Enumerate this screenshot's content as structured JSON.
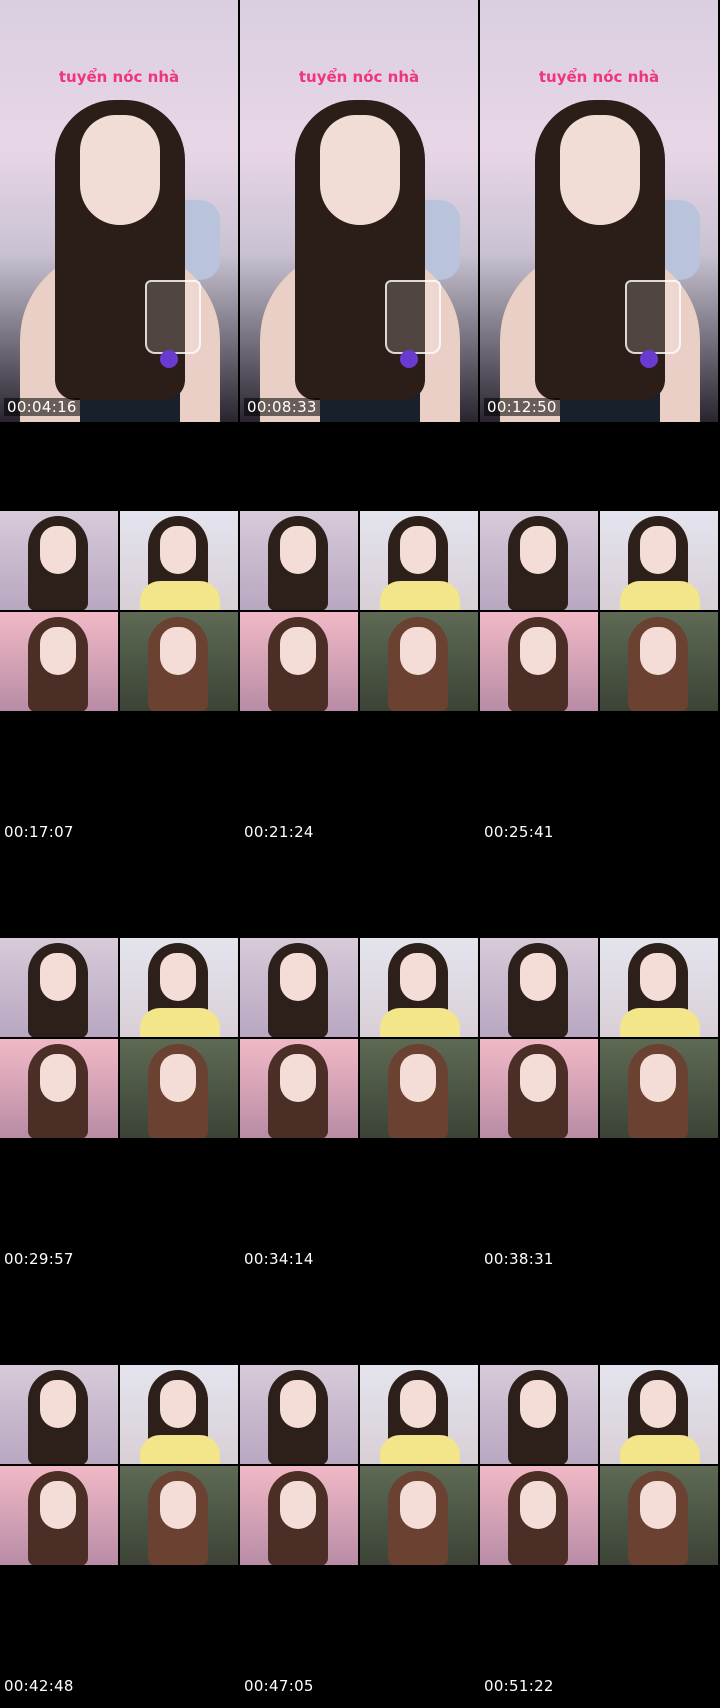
{
  "thumbnails": [
    {
      "timestamp": "00:04:16",
      "layout": "single",
      "overlay_text": "tuyển nóc nhà"
    },
    {
      "timestamp": "00:08:33",
      "layout": "single",
      "overlay_text": "tuyển nóc nhà"
    },
    {
      "timestamp": "00:12:50",
      "layout": "single",
      "overlay_text": "tuyển nóc nhà"
    },
    {
      "timestamp": "00:17:07",
      "layout": "grid"
    },
    {
      "timestamp": "00:21:24",
      "layout": "grid"
    },
    {
      "timestamp": "00:25:41",
      "layout": "grid"
    },
    {
      "timestamp": "00:29:57",
      "layout": "grid"
    },
    {
      "timestamp": "00:34:14",
      "layout": "grid"
    },
    {
      "timestamp": "00:38:31",
      "layout": "grid"
    },
    {
      "timestamp": "00:42:48",
      "layout": "grid"
    },
    {
      "timestamp": "00:47:05",
      "layout": "grid"
    },
    {
      "timestamp": "00:51:22",
      "layout": "grid"
    }
  ]
}
